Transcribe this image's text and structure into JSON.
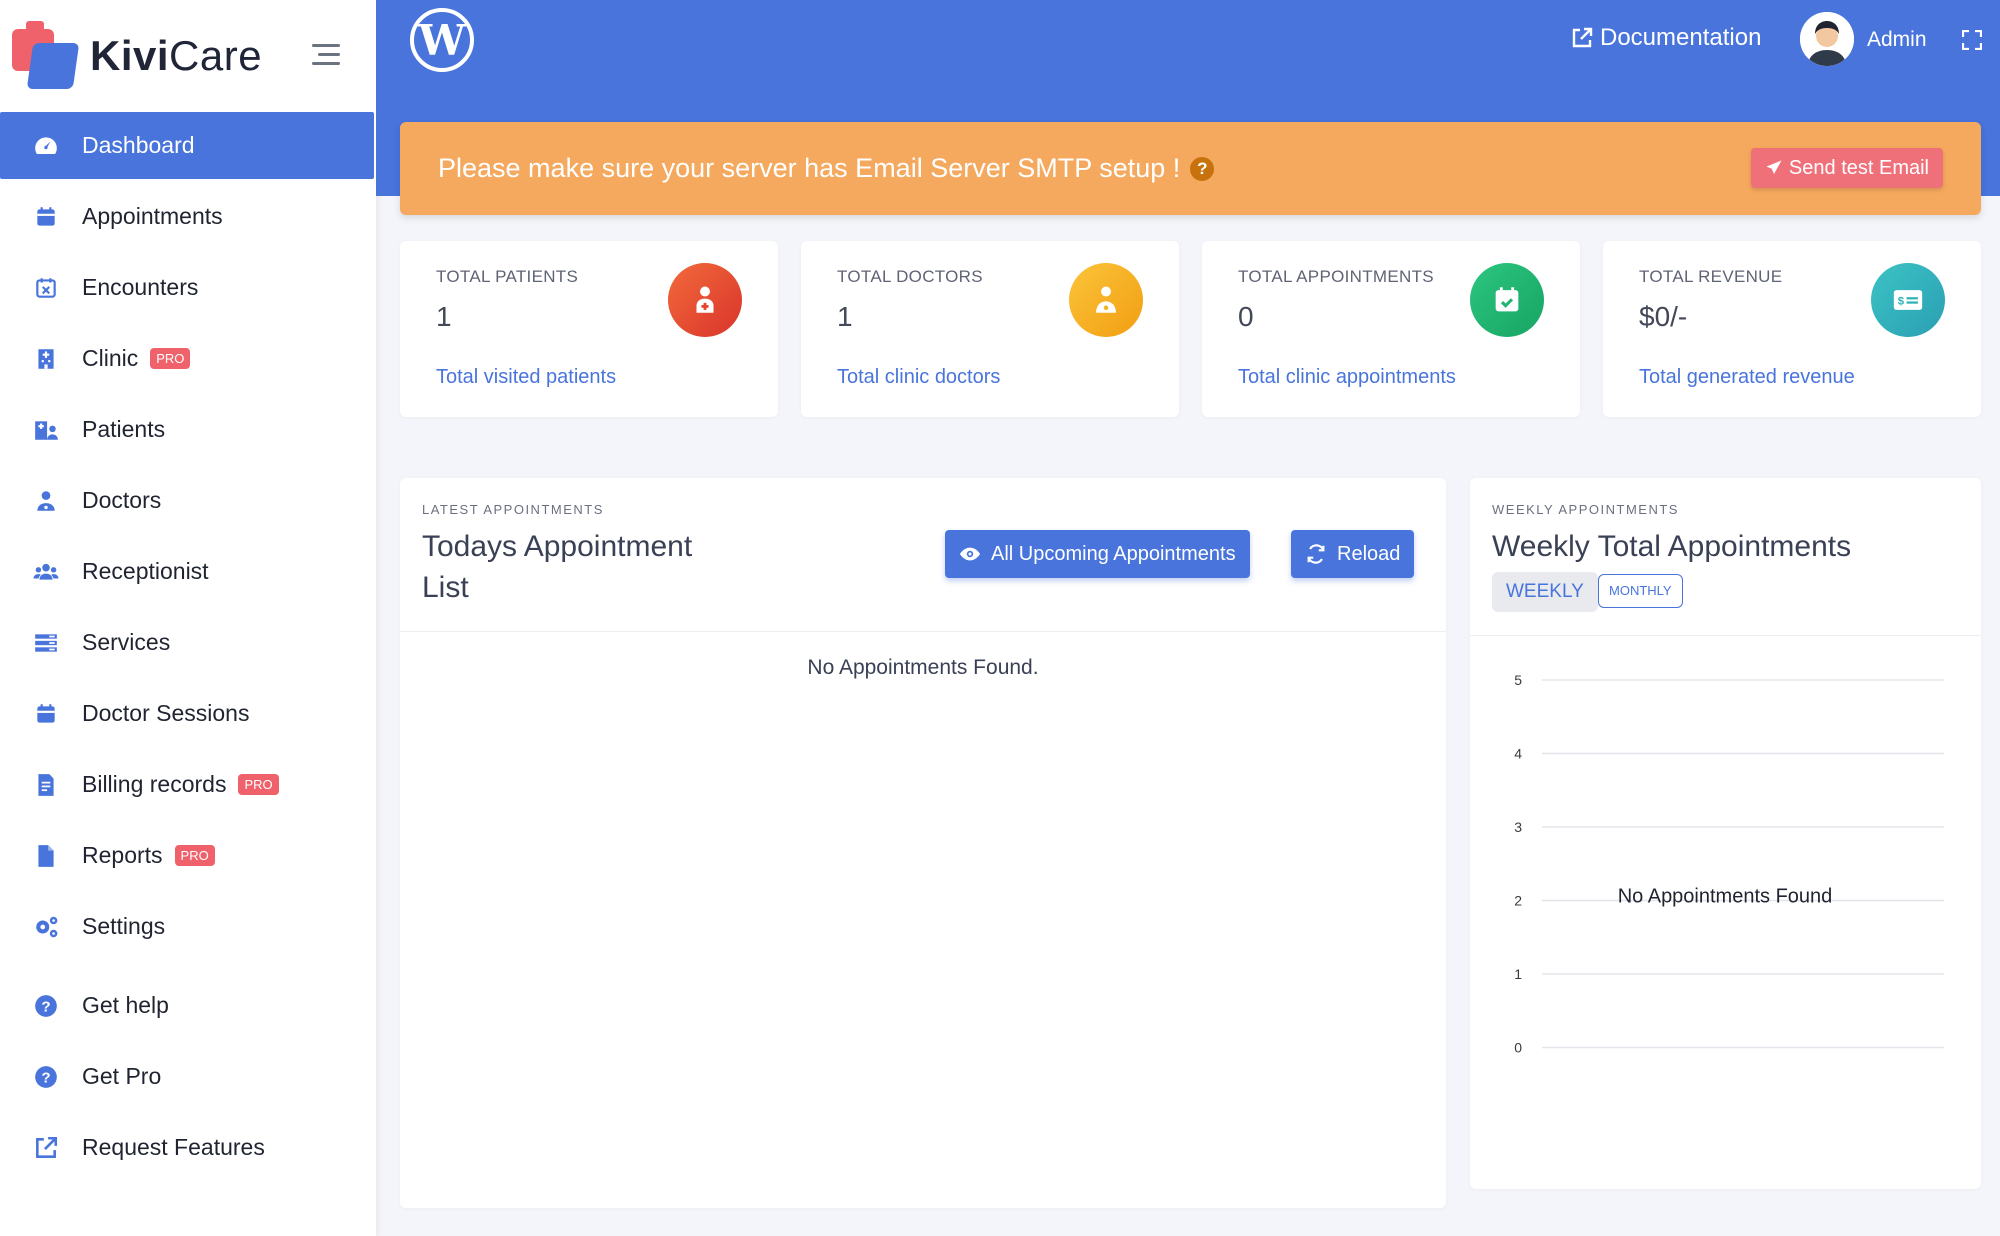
{
  "brand": {
    "part1": "Kivi",
    "part2": "Care"
  },
  "sidebar": {
    "items": [
      {
        "label": "Dashboard",
        "icon": "gauge-icon",
        "pro": ""
      },
      {
        "label": "Appointments",
        "icon": "calendar-icon",
        "pro": ""
      },
      {
        "label": "Encounters",
        "icon": "calendar-x-icon",
        "pro": ""
      },
      {
        "label": "Clinic",
        "icon": "hospital-icon",
        "pro": "PRO"
      },
      {
        "label": "Patients",
        "icon": "hospital-user-icon",
        "pro": ""
      },
      {
        "label": "Doctors",
        "icon": "doctor-icon",
        "pro": ""
      },
      {
        "label": "Receptionist",
        "icon": "users-icon",
        "pro": ""
      },
      {
        "label": "Services",
        "icon": "server-icon",
        "pro": ""
      },
      {
        "label": "Doctor Sessions",
        "icon": "calendar-icon",
        "pro": ""
      },
      {
        "label": "Billing records",
        "icon": "file-invoice-icon",
        "pro": "PRO"
      },
      {
        "label": "Reports",
        "icon": "file-icon",
        "pro": "PRO"
      },
      {
        "label": "Settings",
        "icon": "cogs-icon",
        "pro": ""
      },
      {
        "label": "Get help",
        "icon": "question-circle-icon",
        "pro": ""
      },
      {
        "label": "Get Pro",
        "icon": "question-circle-icon",
        "pro": ""
      },
      {
        "label": "Request Features",
        "icon": "external-link-icon",
        "pro": ""
      }
    ]
  },
  "header": {
    "documentation": "Documentation",
    "user": "Admin"
  },
  "alert": {
    "text": "Please make sure your server has Email Server SMTP setup !",
    "help": "?",
    "button": "Send test Email"
  },
  "stats": [
    {
      "label": "TOTAL PATIENTS",
      "value": "1",
      "link": "Total visited patients",
      "color": "#e8452c"
    },
    {
      "label": "TOTAL DOCTORS",
      "value": "1",
      "link": "Total clinic doctors",
      "color": "#f6b21c"
    },
    {
      "label": "TOTAL APPOINTMENTS",
      "value": "0",
      "link": "Total clinic appointments",
      "color": "#22b573"
    },
    {
      "label": "TOTAL REVENUE",
      "value": "$0/-",
      "link": "Total generated revenue",
      "color": "#2eb3b8"
    }
  ],
  "latest": {
    "eyebrow": "LATEST APPOINTMENTS",
    "title": "Todays Appointment List",
    "upcoming_button": "All Upcoming Appointments",
    "reload_button": "Reload",
    "empty": "No Appointments Found."
  },
  "weekly": {
    "eyebrow": "WEEKLY APPOINTMENTS",
    "title": "Weekly Total Appointments",
    "weekly_toggle": "WEEKLY",
    "monthly_toggle": "MONTHLY"
  },
  "chart_data": {
    "type": "line",
    "title": "",
    "xlabel": "",
    "ylabel": "",
    "ylim": [
      0,
      5
    ],
    "yticks": [
      "5",
      "4",
      "3",
      "2",
      "1",
      "0"
    ],
    "series": [],
    "annotation": "No Appointments Found",
    "grid": true
  },
  "colors": {
    "primary": "#4874dc",
    "alert": "#f5a95e",
    "pro_badge": "#f0626b"
  }
}
